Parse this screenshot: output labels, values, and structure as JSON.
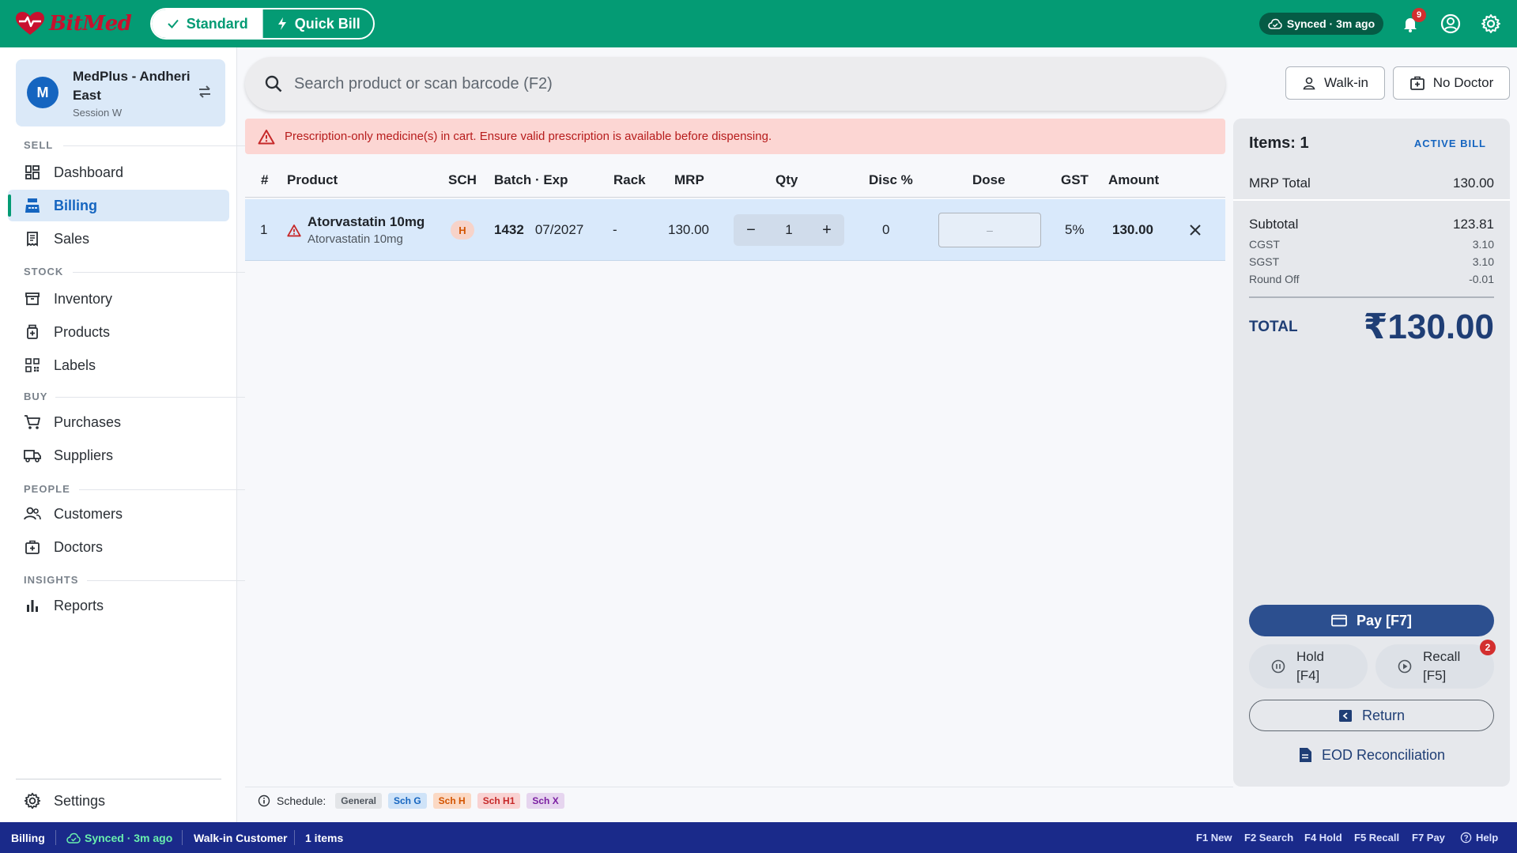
{
  "app": {
    "brand": "BitMed",
    "colors": {
      "primary": "#049b74",
      "accent": "#1565c0",
      "danger": "#d32f2f",
      "statusbar": "#1a2a8a"
    }
  },
  "topbar": {
    "mode_standard": "Standard",
    "mode_quick": "Quick Bill",
    "sync_status": "Synced · 3m ago",
    "notification_count": "9"
  },
  "store": {
    "avatar_letter": "M",
    "name": "MedPlus - Andheri East",
    "session": "Session W"
  },
  "sidebar": {
    "sections": {
      "sell": "SELL",
      "stock": "STOCK",
      "buy": "BUY",
      "people": "PEOPLE",
      "insights": "INSIGHTS"
    },
    "items": {
      "dashboard": "Dashboard",
      "billing": "Billing",
      "sales": "Sales",
      "inventory": "Inventory",
      "products": "Products",
      "labels": "Labels",
      "purchases": "Purchases",
      "suppliers": "Suppliers",
      "customers": "Customers",
      "doctors": "Doctors",
      "reports": "Reports",
      "settings": "Settings"
    }
  },
  "search": {
    "placeholder": "Search product or scan barcode (F2)"
  },
  "header_buttons": {
    "walkin": "Walk-in",
    "doctor": "No Doctor"
  },
  "warning": {
    "text": "Prescription-only medicine(s) in cart. Ensure valid prescription is available before dispensing."
  },
  "table": {
    "headers": {
      "num": "#",
      "product": "Product",
      "sch": "SCH",
      "batch_exp": "Batch · Exp",
      "rack": "Rack",
      "mrp": "MRP",
      "qty": "Qty",
      "disc": "Disc %",
      "dose": "Dose",
      "gst": "GST",
      "amount": "Amount"
    },
    "rows": [
      {
        "num": "1",
        "name": "Atorvastatin 10mg",
        "generic": "Atorvastatin 10mg",
        "sch": "H",
        "batch": "1432",
        "exp": "07/2027",
        "rack": "-",
        "mrp": "130.00",
        "qty": "1",
        "disc": "0",
        "dose": "–",
        "gst": "5%",
        "amount": "130.00"
      }
    ]
  },
  "legend": {
    "label": "Schedule:",
    "chips": {
      "general": "General",
      "g": "Sch G",
      "h": "Sch H",
      "h1": "Sch H1",
      "x": "Sch X"
    }
  },
  "summary": {
    "items_label": "Items: 1",
    "active_bill": "ACTIVE BILL",
    "mrp_total_label": "MRP Total",
    "mrp_total": "130.00",
    "subtotal_label": "Subtotal",
    "subtotal": "123.81",
    "cgst_label": "CGST",
    "cgst": "3.10",
    "sgst_label": "SGST",
    "sgst": "3.10",
    "round_label": "Round Off",
    "round": "-0.01",
    "total_label": "TOTAL",
    "total": "₹130.00",
    "pay": "Pay  [F7]",
    "hold_line1": "Hold",
    "hold_line2": "[F4]",
    "recall_line1": "Recall",
    "recall_line2": "[F5]",
    "recall_count": "2",
    "return": "Return",
    "eod": "EOD Reconciliation"
  },
  "statusbar": {
    "page": "Billing",
    "sync": "Synced · 3m ago",
    "customer": "Walk-in Customer",
    "items": "1 items",
    "keys": {
      "new": "F1 New",
      "search": "F2 Search",
      "hold": "F4 Hold",
      "recall": "F5 Recall",
      "pay": "F7 Pay",
      "help": "Help"
    }
  }
}
